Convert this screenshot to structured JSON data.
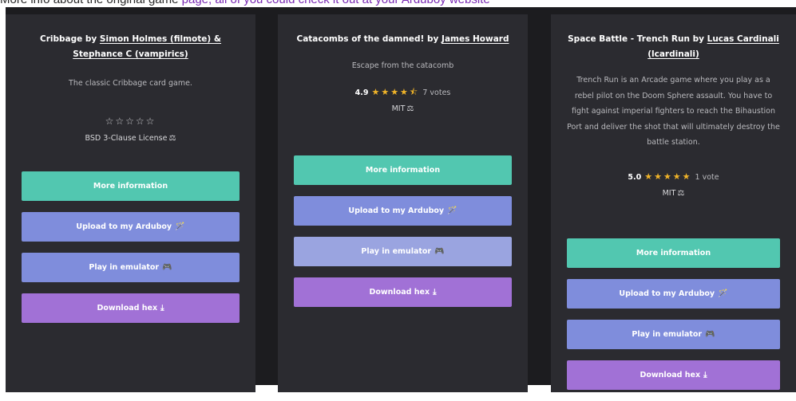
{
  "top_text": {
    "before": "More info about the original game ",
    "link_mid": "page, all of you could check it out",
    "after": " at your Arduboy website"
  },
  "cards": [
    {
      "title_prefix": "Cribbage by ",
      "author": "Simon Holmes (filmote) & Stephance C (vampirics)",
      "description": "The classic Cribbage card game.",
      "rating_score": "",
      "rating_stars": "☆☆☆☆☆",
      "rating_votes": "",
      "rating_value": 0,
      "license": "BSD 3-Clause License",
      "license_icon": "balance-scale-icon",
      "buttons": {
        "info": "More information",
        "upload": "Upload to my Arduboy",
        "play": "Play in emulator",
        "download": "Download hex"
      }
    },
    {
      "title_prefix": "Catacombs of the damned! by ",
      "author": "James Howard",
      "description": "Escape from the catacomb",
      "rating_score": "4.9",
      "rating_stars": "★★★★⯪",
      "rating_votes": "7 votes",
      "rating_value": 4.9,
      "license": "MIT",
      "license_icon": "balance-scale-icon",
      "buttons": {
        "info": "More information",
        "upload": "Upload to my Arduboy",
        "play": "Play in emulator",
        "download": "Download hex"
      }
    },
    {
      "title_prefix": "Space Battle - Trench Run by ",
      "author": "Lucas Cardinali (lcardinali)",
      "description": "Trench Run is an Arcade game where you play as a rebel pilot on the Doom Sphere assault. You have to fight against imperial fighters to reach the Bihaustion Port and deliver the shot that will ultimately destroy the battle station.",
      "rating_score": "5.0",
      "rating_stars": "★★★★★",
      "rating_votes": "1 vote",
      "rating_value": 5.0,
      "license": "MIT",
      "license_icon": "balance-scale-icon",
      "buttons": {
        "info": "More information",
        "upload": "Upload to my Arduboy",
        "play": "Play in emulator",
        "download": "Download hex"
      }
    }
  ],
  "icons": {
    "upload": "wand-icon",
    "play": "gamepad-icon",
    "download": "download-icon"
  },
  "colors": {
    "background": "#1c1c1f",
    "card": "#2b2b30",
    "info_button": "#52c7b0",
    "upload_button": "#7f8ddc",
    "download_button": "#a171d6",
    "star": "#f0b429"
  }
}
